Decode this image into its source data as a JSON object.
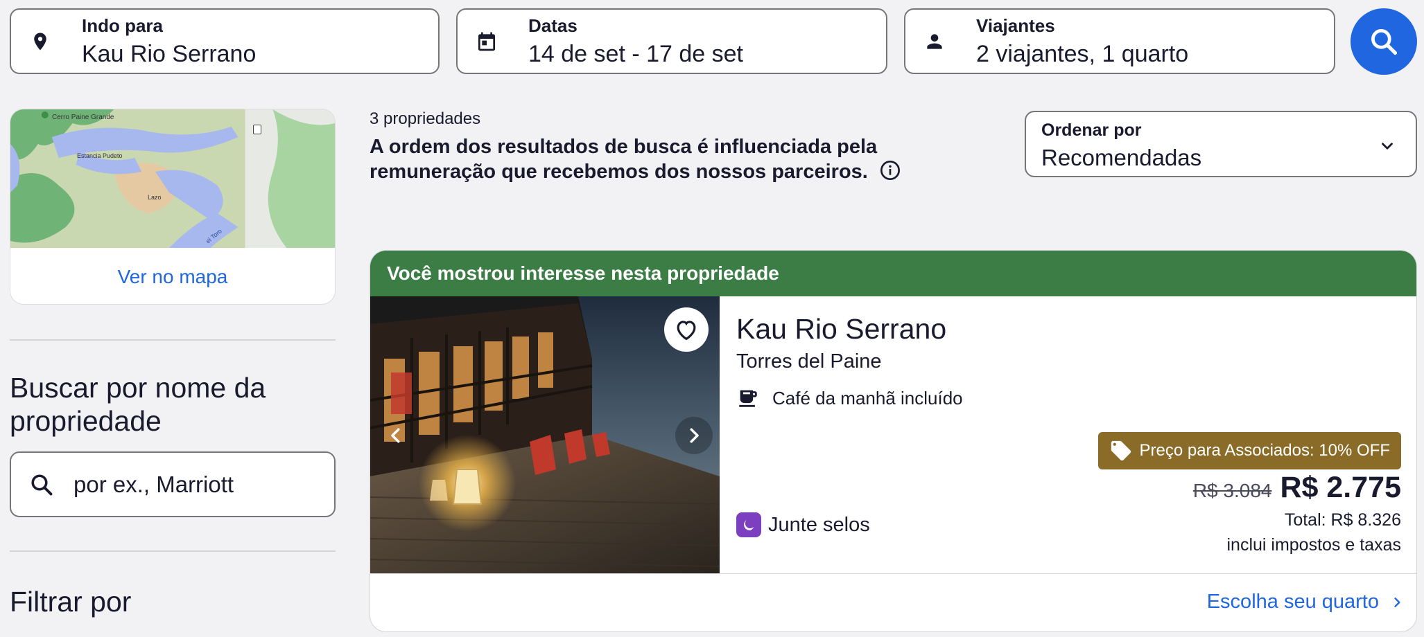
{
  "search": {
    "destination": {
      "label": "Indo para",
      "value": "Kau Rio Serrano"
    },
    "dates": {
      "label": "Datas",
      "value": "14 de set - 17 de set"
    },
    "travelers": {
      "label": "Viajantes",
      "value": "2 viajantes, 1 quarto"
    }
  },
  "sidebar": {
    "map": {
      "link_label": "Ver no mapa",
      "place_labels": [
        "Cerro Paine Grande",
        "Estancia Pudeto",
        "Lazo",
        "el Toro"
      ]
    },
    "name_search": {
      "title": "Buscar por nome da propriedade",
      "placeholder": "por ex., Marriott"
    },
    "filter_title": "Filtrar por"
  },
  "results": {
    "count": "3 propriedades",
    "disclaimer": "A ordem dos resultados de busca é influenciada pela remuneração que recebemos dos nossos parceiros.",
    "sort": {
      "label": "Ordenar por",
      "value": "Recomendadas"
    }
  },
  "card": {
    "banner": "Você mostrou interesse nesta propriedade",
    "name": "Kau Rio Serrano",
    "location": "Torres del Paine",
    "amenity": "Café da manhã incluído",
    "stamps": "Junte selos",
    "member_tag": "Preço para Associados: 10% OFF",
    "old_price": "R$ 3.084",
    "new_price": "R$ 2.775",
    "total": "Total: R$ 8.326",
    "taxes": "inclui impostos e taxas",
    "cta": "Escolha seu quarto"
  },
  "colors": {
    "accent": "#1f66e0",
    "banner": "#3b7d44",
    "member_tag": "#8a6b27",
    "stamps_badge": "#7b3fbf"
  }
}
